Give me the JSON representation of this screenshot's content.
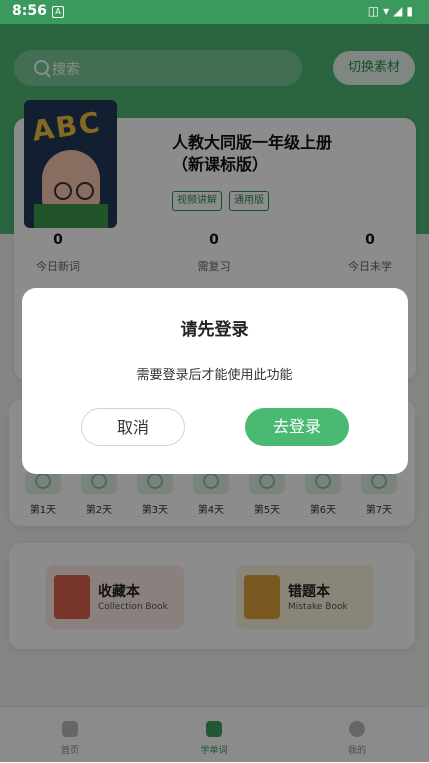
{
  "status_bar": {
    "time": "8:56",
    "a_icon": "A"
  },
  "header": {
    "search_placeholder": "搜索",
    "switch_label": "切换素材"
  },
  "book": {
    "title": "人教大同版一年级上册（新课标版）",
    "tags": [
      "视频讲解",
      "通用版"
    ],
    "cover_text": "ABC"
  },
  "stats": [
    {
      "value": "0",
      "label": "今日新词"
    },
    {
      "value": "0",
      "label": "需复习"
    },
    {
      "value": "0",
      "label": "今日未学"
    }
  ],
  "week": {
    "days": [
      "第1天",
      "第2天",
      "第3天",
      "第4天",
      "第5天",
      "第6天",
      "第7天"
    ]
  },
  "books": [
    {
      "title": "收藏本",
      "subtitle": "Collection Book",
      "icon": "star-book-icon"
    },
    {
      "title": "错题本",
      "subtitle": "Mistake Book",
      "icon": "x-book-icon"
    }
  ],
  "tabs": [
    {
      "label": "首页",
      "icon": "home-icon"
    },
    {
      "label": "学单词",
      "icon": "word-book-icon",
      "active": true
    },
    {
      "label": "我的",
      "icon": "profile-icon"
    }
  ],
  "dialog": {
    "title": "请先登录",
    "message": "需要登录后才能使用此功能",
    "cancel_label": "取消",
    "login_label": "去登录"
  }
}
